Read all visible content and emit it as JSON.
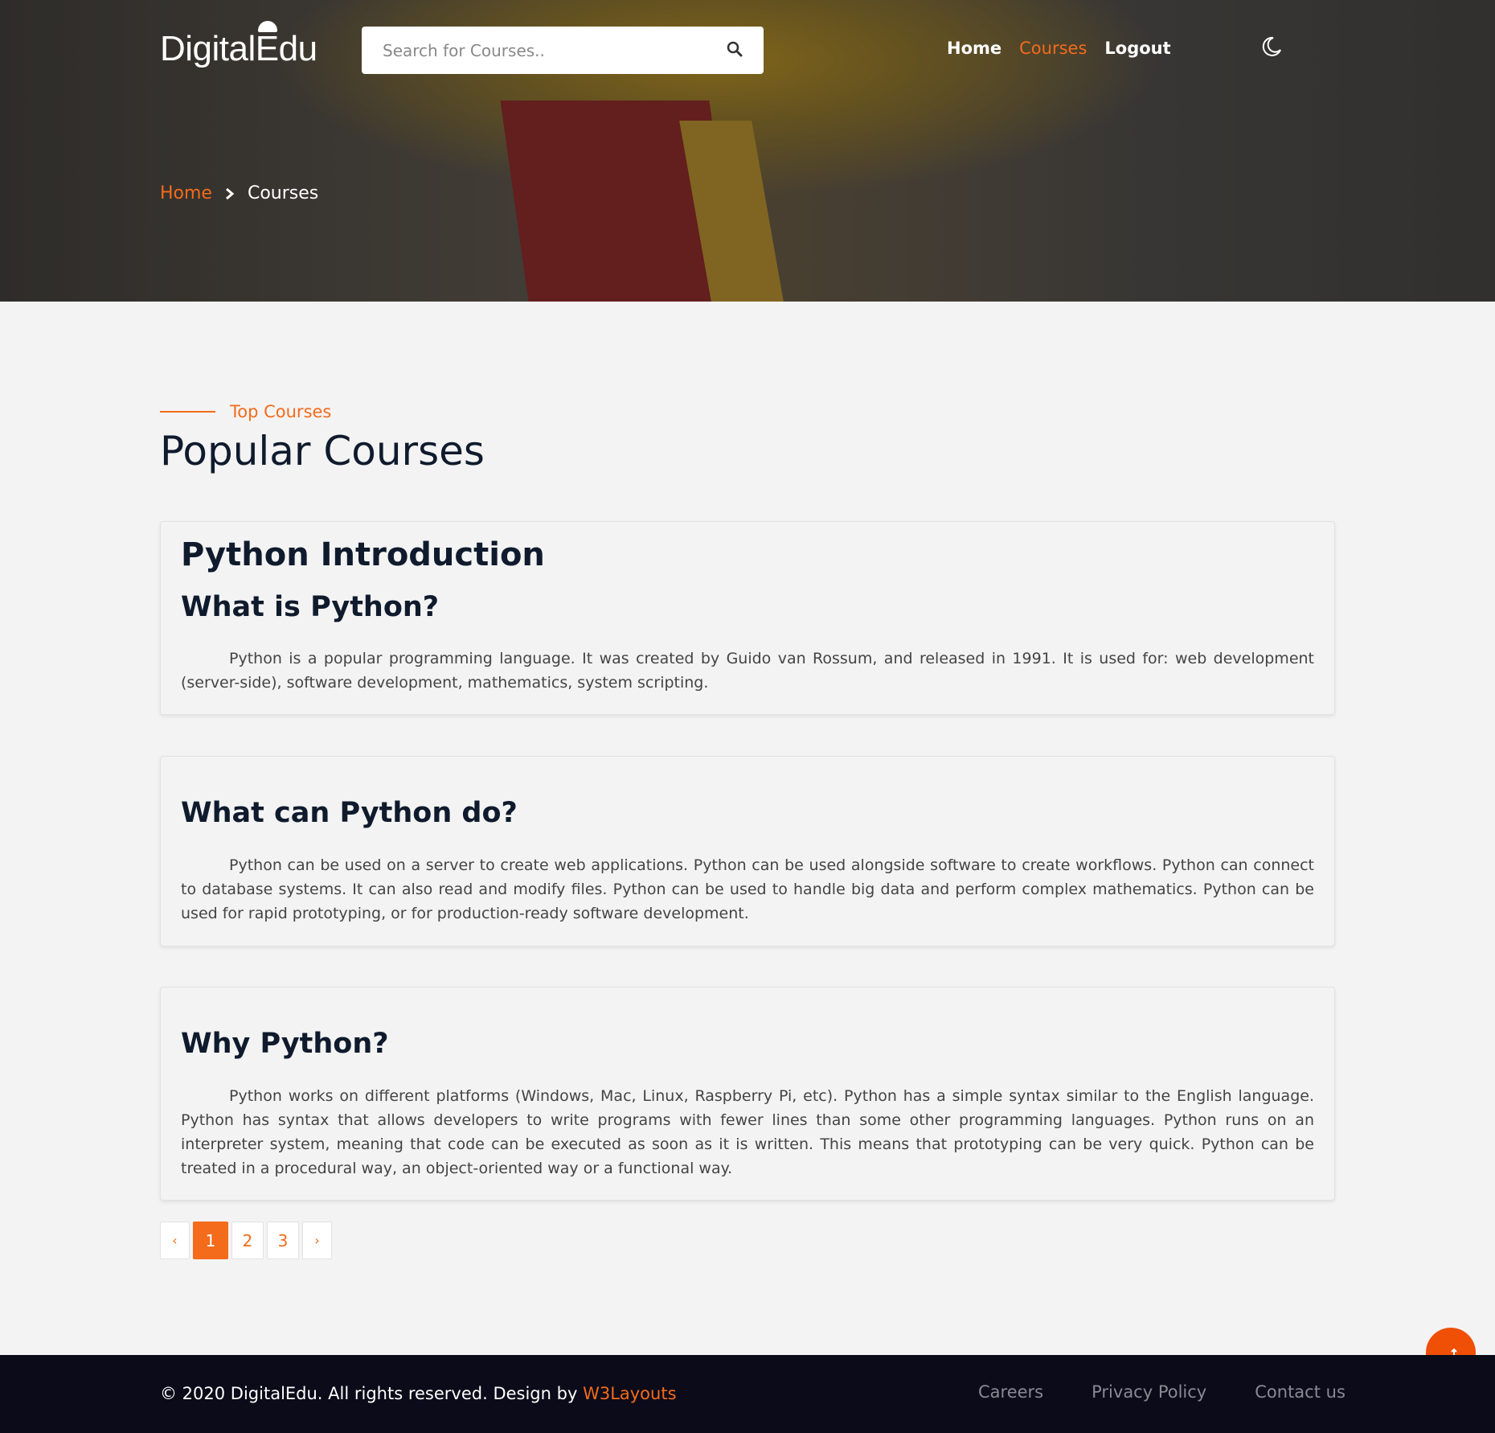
{
  "header": {
    "logo": "DigitalEdu",
    "search_placeholder": "Search for Courses..",
    "nav": [
      {
        "label": "Home",
        "active": false
      },
      {
        "label": "Courses",
        "active": true
      },
      {
        "label": "Logout",
        "active": false
      }
    ]
  },
  "breadcrumb": {
    "home": "Home",
    "current": "Courses"
  },
  "section": {
    "tag": "Top Courses",
    "title": "Popular Courses"
  },
  "cards": [
    {
      "title": "Python Introduction",
      "heading": "What is Python?",
      "body": "Python is a popular programming language. It was created by Guido van Rossum, and released in 1991. It is used for: web development (server-side), software development, mathematics, system scripting."
    },
    {
      "heading": "What can Python do?",
      "body": "Python can be used on a server to create web applications. Python can be used alongside software to create workflows. Python can connect to database systems. It can also read and modify files. Python can be used to handle big data and perform complex mathematics. Python can be used for rapid prototyping, or for production-ready software development."
    },
    {
      "heading": "Why Python?",
      "body": "Python works on different platforms (Windows, Mac, Linux, Raspberry Pi, etc). Python has a simple syntax similar to the English language. Python has syntax that allows developers to write programs with fewer lines than some other programming languages. Python runs on an interpreter system, meaning that code can be executed as soon as it is written. This means that prototyping can be very quick. Python can be treated in a procedural way, an object-oriented way or a functional way."
    }
  ],
  "pagination": {
    "prev": "‹",
    "pages": [
      "1",
      "2",
      "3"
    ],
    "current": "1",
    "next": "›"
  },
  "footer": {
    "copyright": "© 2020 DigitalEdu. All rights reserved. Design by ",
    "design_link": "W3Layouts",
    "links": [
      "Careers",
      "Privacy Policy",
      "Contact us"
    ]
  },
  "colors": {
    "accent": "#f46b1b",
    "footer_bg": "#0b0b1a",
    "page_bg": "#f3f3f3"
  },
  "icons": {
    "search": "search-icon",
    "theme": "moon-icon",
    "breadcrumb_sep": "chevron-right-icon",
    "scroll_top": "arrow-up-icon"
  }
}
